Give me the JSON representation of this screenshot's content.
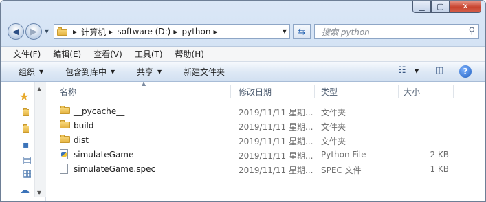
{
  "address": {
    "crumbs": [
      "计算机",
      "software (D:)",
      "python"
    ]
  },
  "search": {
    "placeholder": "搜索 python"
  },
  "menu": [
    "文件(F)",
    "编辑(E)",
    "查看(V)",
    "工具(T)",
    "帮助(H)"
  ],
  "toolbar": {
    "organize": "组织",
    "include_library": "包含到库中",
    "share": "共享",
    "new_folder": "新建文件夹"
  },
  "columns": {
    "name": "名称",
    "date": "修改日期",
    "type": "类型",
    "size": "大小"
  },
  "files": [
    {
      "name": "__pycache__",
      "date": "2019/11/11 星期...",
      "type": "文件夹",
      "size": "",
      "icon": "folder-icon"
    },
    {
      "name": "build",
      "date": "2019/11/11 星期...",
      "type": "文件夹",
      "size": "",
      "icon": "folder-icon"
    },
    {
      "name": "dist",
      "date": "2019/11/11 星期...",
      "type": "文件夹",
      "size": "",
      "icon": "folder-icon"
    },
    {
      "name": "simulateGame",
      "date": "2019/11/11 星期...",
      "type": "Python File",
      "size": "2 KB",
      "icon": "python-file-icon"
    },
    {
      "name": "simulateGame.spec",
      "date": "2019/11/11 星期...",
      "type": "SPEC 文件",
      "size": "1 KB",
      "icon": "document-icon"
    }
  ],
  "colors": {
    "accent": "#3b73b9",
    "folder": "#e5b443",
    "close": "#c8442f"
  }
}
